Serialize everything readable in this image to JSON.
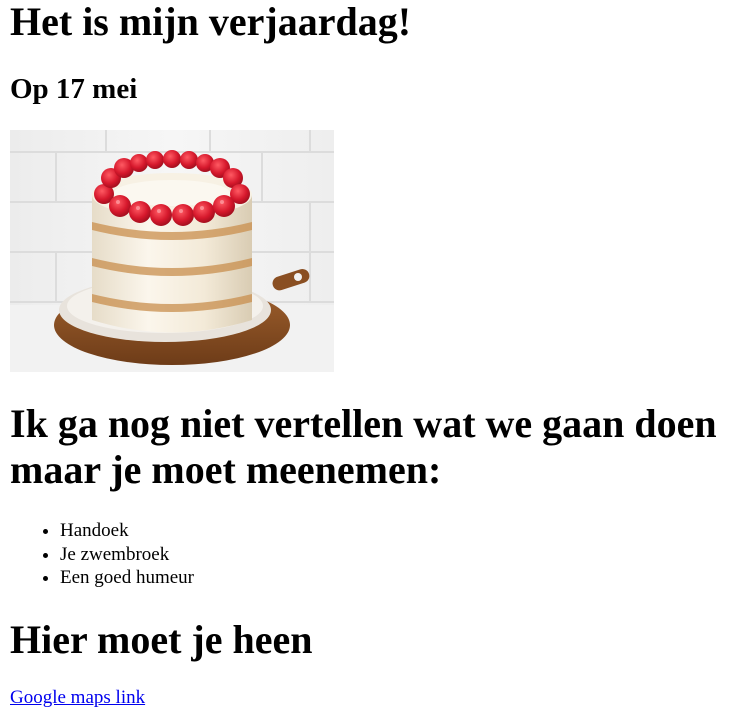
{
  "page": {
    "title": "Het is mijn verjaardag!",
    "date": "Op 17 mei",
    "intro": "Ik ga nog niet vertellen wat we gaan doen maar je moet meenemen:",
    "bring_items": [
      "Handoek",
      "Je zwembroek",
      "Een goed humeur"
    ],
    "route_heading": "Hier moet je heen",
    "maps_link": "Google maps link"
  },
  "image": {
    "subject": "cake-with-raspberries"
  },
  "colors": {
    "text": "#000000",
    "link": "#0000ee",
    "background": "#ffffff"
  }
}
